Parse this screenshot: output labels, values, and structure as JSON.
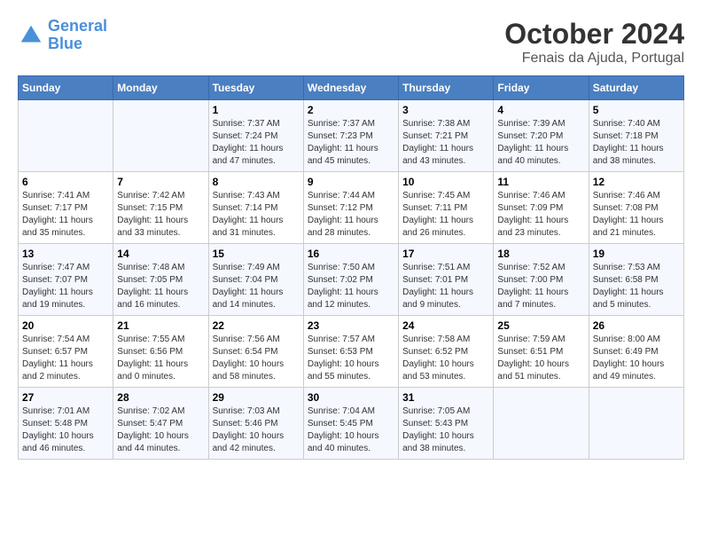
{
  "header": {
    "logo_line1": "General",
    "logo_line2": "Blue",
    "title": "October 2024",
    "subtitle": "Fenais da Ajuda, Portugal"
  },
  "columns": [
    "Sunday",
    "Monday",
    "Tuesday",
    "Wednesday",
    "Thursday",
    "Friday",
    "Saturday"
  ],
  "weeks": [
    [
      {
        "day": "",
        "info": ""
      },
      {
        "day": "",
        "info": ""
      },
      {
        "day": "1",
        "info": "Sunrise: 7:37 AM\nSunset: 7:24 PM\nDaylight: 11 hours and 47 minutes."
      },
      {
        "day": "2",
        "info": "Sunrise: 7:37 AM\nSunset: 7:23 PM\nDaylight: 11 hours and 45 minutes."
      },
      {
        "day": "3",
        "info": "Sunrise: 7:38 AM\nSunset: 7:21 PM\nDaylight: 11 hours and 43 minutes."
      },
      {
        "day": "4",
        "info": "Sunrise: 7:39 AM\nSunset: 7:20 PM\nDaylight: 11 hours and 40 minutes."
      },
      {
        "day": "5",
        "info": "Sunrise: 7:40 AM\nSunset: 7:18 PM\nDaylight: 11 hours and 38 minutes."
      }
    ],
    [
      {
        "day": "6",
        "info": "Sunrise: 7:41 AM\nSunset: 7:17 PM\nDaylight: 11 hours and 35 minutes."
      },
      {
        "day": "7",
        "info": "Sunrise: 7:42 AM\nSunset: 7:15 PM\nDaylight: 11 hours and 33 minutes."
      },
      {
        "day": "8",
        "info": "Sunrise: 7:43 AM\nSunset: 7:14 PM\nDaylight: 11 hours and 31 minutes."
      },
      {
        "day": "9",
        "info": "Sunrise: 7:44 AM\nSunset: 7:12 PM\nDaylight: 11 hours and 28 minutes."
      },
      {
        "day": "10",
        "info": "Sunrise: 7:45 AM\nSunset: 7:11 PM\nDaylight: 11 hours and 26 minutes."
      },
      {
        "day": "11",
        "info": "Sunrise: 7:46 AM\nSunset: 7:09 PM\nDaylight: 11 hours and 23 minutes."
      },
      {
        "day": "12",
        "info": "Sunrise: 7:46 AM\nSunset: 7:08 PM\nDaylight: 11 hours and 21 minutes."
      }
    ],
    [
      {
        "day": "13",
        "info": "Sunrise: 7:47 AM\nSunset: 7:07 PM\nDaylight: 11 hours and 19 minutes."
      },
      {
        "day": "14",
        "info": "Sunrise: 7:48 AM\nSunset: 7:05 PM\nDaylight: 11 hours and 16 minutes."
      },
      {
        "day": "15",
        "info": "Sunrise: 7:49 AM\nSunset: 7:04 PM\nDaylight: 11 hours and 14 minutes."
      },
      {
        "day": "16",
        "info": "Sunrise: 7:50 AM\nSunset: 7:02 PM\nDaylight: 11 hours and 12 minutes."
      },
      {
        "day": "17",
        "info": "Sunrise: 7:51 AM\nSunset: 7:01 PM\nDaylight: 11 hours and 9 minutes."
      },
      {
        "day": "18",
        "info": "Sunrise: 7:52 AM\nSunset: 7:00 PM\nDaylight: 11 hours and 7 minutes."
      },
      {
        "day": "19",
        "info": "Sunrise: 7:53 AM\nSunset: 6:58 PM\nDaylight: 11 hours and 5 minutes."
      }
    ],
    [
      {
        "day": "20",
        "info": "Sunrise: 7:54 AM\nSunset: 6:57 PM\nDaylight: 11 hours and 2 minutes."
      },
      {
        "day": "21",
        "info": "Sunrise: 7:55 AM\nSunset: 6:56 PM\nDaylight: 11 hours and 0 minutes."
      },
      {
        "day": "22",
        "info": "Sunrise: 7:56 AM\nSunset: 6:54 PM\nDaylight: 10 hours and 58 minutes."
      },
      {
        "day": "23",
        "info": "Sunrise: 7:57 AM\nSunset: 6:53 PM\nDaylight: 10 hours and 55 minutes."
      },
      {
        "day": "24",
        "info": "Sunrise: 7:58 AM\nSunset: 6:52 PM\nDaylight: 10 hours and 53 minutes."
      },
      {
        "day": "25",
        "info": "Sunrise: 7:59 AM\nSunset: 6:51 PM\nDaylight: 10 hours and 51 minutes."
      },
      {
        "day": "26",
        "info": "Sunrise: 8:00 AM\nSunset: 6:49 PM\nDaylight: 10 hours and 49 minutes."
      }
    ],
    [
      {
        "day": "27",
        "info": "Sunrise: 7:01 AM\nSunset: 5:48 PM\nDaylight: 10 hours and 46 minutes."
      },
      {
        "day": "28",
        "info": "Sunrise: 7:02 AM\nSunset: 5:47 PM\nDaylight: 10 hours and 44 minutes."
      },
      {
        "day": "29",
        "info": "Sunrise: 7:03 AM\nSunset: 5:46 PM\nDaylight: 10 hours and 42 minutes."
      },
      {
        "day": "30",
        "info": "Sunrise: 7:04 AM\nSunset: 5:45 PM\nDaylight: 10 hours and 40 minutes."
      },
      {
        "day": "31",
        "info": "Sunrise: 7:05 AM\nSunset: 5:43 PM\nDaylight: 10 hours and 38 minutes."
      },
      {
        "day": "",
        "info": ""
      },
      {
        "day": "",
        "info": ""
      }
    ]
  ]
}
